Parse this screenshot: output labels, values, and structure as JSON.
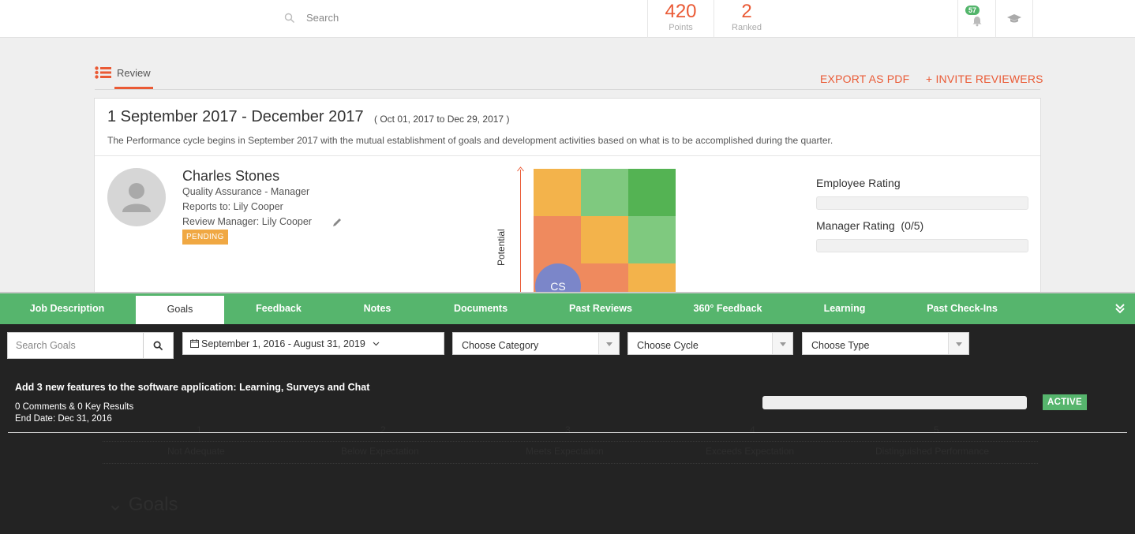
{
  "topbar": {
    "search_placeholder": "Search",
    "points": {
      "value": "420",
      "label": "Points"
    },
    "ranked": {
      "value": "2",
      "label": "Ranked"
    },
    "notifications_count": "57",
    "icons": [
      "search-icon",
      "bell-icon",
      "graduation-cap-icon"
    ]
  },
  "review_header": {
    "tab_label": "Review",
    "export_label": "EXPORT AS PDF",
    "invite_label": "+ INVITE REVIEWERS"
  },
  "cycle": {
    "title": "1 September 2017 - December 2017",
    "range": "( Oct 01, 2017 to Dec 29, 2017 )",
    "description": "The Performance cycle begins in September 2017 with the mutual establishment of goals and development activities based on what is to be accomplished during the quarter."
  },
  "employee": {
    "name": "Charles Stones",
    "role": "Quality Assurance - Manager",
    "reports_to": "Reports to: Lily Cooper",
    "review_manager": "Review Manager: Lily Cooper",
    "status": "PENDING"
  },
  "nine_box": {
    "axis_label": "Potential",
    "marker": "CS",
    "colors": [
      "#f3b34b",
      "#7fc97f",
      "#54b353",
      "#ef8a5e",
      "#f3b34b",
      "#7fc97f",
      "#ef8a5e",
      "#ef8a5e",
      "#f3b34b"
    ]
  },
  "ratings": {
    "employee_label": "Employee Rating",
    "manager_label": "Manager Rating",
    "manager_score": "(0/5)"
  },
  "tabs": [
    "Job Description",
    "Goals",
    "Feedback",
    "Notes",
    "Documents",
    "Past Reviews",
    "360° Feedback",
    "Learning",
    "Past Check-Ins"
  ],
  "active_tab": "Goals",
  "filters": {
    "search_placeholder": "Search Goals",
    "date_range": "September 1, 2016 - August 31, 2019",
    "category": "Choose Category",
    "cycle": "Choose Cycle",
    "type": "Choose Type"
  },
  "goal": {
    "title": "Add 3 new features to the software application: Learning, Surveys and Chat",
    "counts": "0 Comments & 0 Key Results",
    "end_date": "End Date: Dec 31, 2016",
    "status": "ACTIVE"
  },
  "background_scale": {
    "numbers": [
      "1",
      "2",
      "3",
      "4",
      "5"
    ],
    "labels": [
      "Not Adequate",
      "Below Expectation",
      "Meets Expectation",
      "Exceeds Expectation",
      "Distinguished Performance"
    ],
    "section_title": "Goals"
  }
}
